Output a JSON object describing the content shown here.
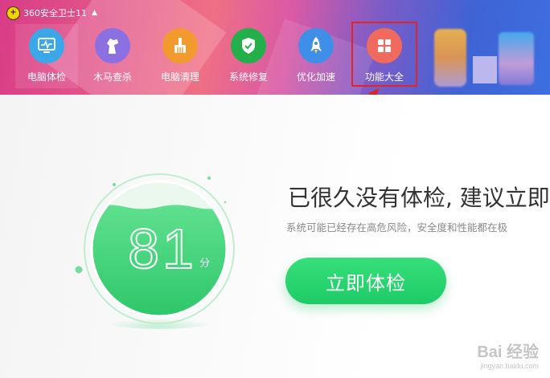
{
  "app": {
    "title": "360安全卫士11"
  },
  "nav": {
    "items": [
      {
        "label": "电脑体检",
        "icon": "monitor-icon",
        "color": "#3aa7e8"
      },
      {
        "label": "木马查杀",
        "icon": "horse-icon",
        "color": "#8c6fe0"
      },
      {
        "label": "电脑清理",
        "icon": "broom-icon",
        "color": "#f29a2e"
      },
      {
        "label": "系统修复",
        "icon": "shield-check-icon",
        "color": "#23b04a"
      },
      {
        "label": "优化加速",
        "icon": "rocket-icon",
        "color": "#3f8ee8"
      },
      {
        "label": "功能大全",
        "icon": "grid-icon",
        "color": "#f06b5d"
      }
    ]
  },
  "score": {
    "value": "81",
    "unit": "分",
    "level": 0.81
  },
  "main": {
    "headline": "已很久没有体检, 建议立即",
    "subline": "系统可能已经存在高危风险，安全度和性能都在极",
    "button_label": "立即体检"
  },
  "watermark": {
    "text": "Bai 经验",
    "sub": "jingyan.baidu.com"
  },
  "colors": {
    "accent_green": "#22cc66",
    "highlight_red": "#e0242a"
  }
}
